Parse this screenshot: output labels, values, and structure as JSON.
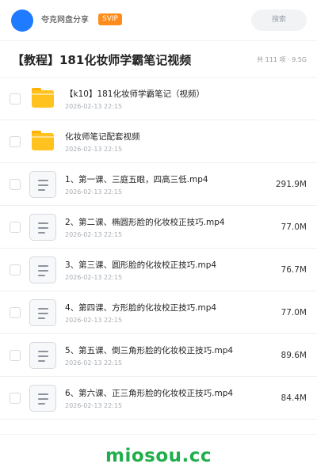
{
  "header": {
    "brand": "夸克网盘分享",
    "badge": "SVIP",
    "search_label": "搜索"
  },
  "title_bar": {
    "title": "【教程】181化妆师学霸笔记视频",
    "meta": "共 111 项 · 9.5G"
  },
  "files": [
    {
      "name": "【k10】181化妆师学霸笔记（视频）",
      "date": "2026-02-13 22:15",
      "size": "",
      "icon": "folder-icon"
    },
    {
      "name": "化妆师笔记配套视频",
      "date": "2026-02-13 22:15",
      "size": "",
      "icon": "folder-icon"
    },
    {
      "name": "1、第一课、三庭五眼，四高三低.mp4",
      "date": "2026-02-13 22:15",
      "size": "291.9M",
      "icon": "document-icon"
    },
    {
      "name": "2、第二课、椭圆形脸的化妆校正技巧.mp4",
      "date": "2026-02-13 22:15",
      "size": "77.0M",
      "icon": "document-icon"
    },
    {
      "name": "3、第三课、圆形脸的化妆校正技巧.mp4",
      "date": "2026-02-13 22:15",
      "size": "76.7M",
      "icon": "document-icon"
    },
    {
      "name": "4、第四课、方形脸的化妆校正技巧.mp4",
      "date": "2026-02-13 22:15",
      "size": "77.0M",
      "icon": "document-icon"
    },
    {
      "name": "5、第五课、倒三角形脸的化妆校正技巧.mp4",
      "date": "2026-02-13 22:15",
      "size": "89.6M",
      "icon": "document-icon"
    },
    {
      "name": "6、第六课、正三角形脸的化妆校正技巧.mp4",
      "date": "2026-02-13 22:15",
      "size": "84.4M",
      "icon": "document-icon"
    }
  ],
  "watermark": "miosou.cc",
  "colors": {
    "accent": "#1f7bff",
    "badge": "#ff8c1a",
    "folder": "#ffc21e",
    "watermark": "#1fae4b"
  }
}
